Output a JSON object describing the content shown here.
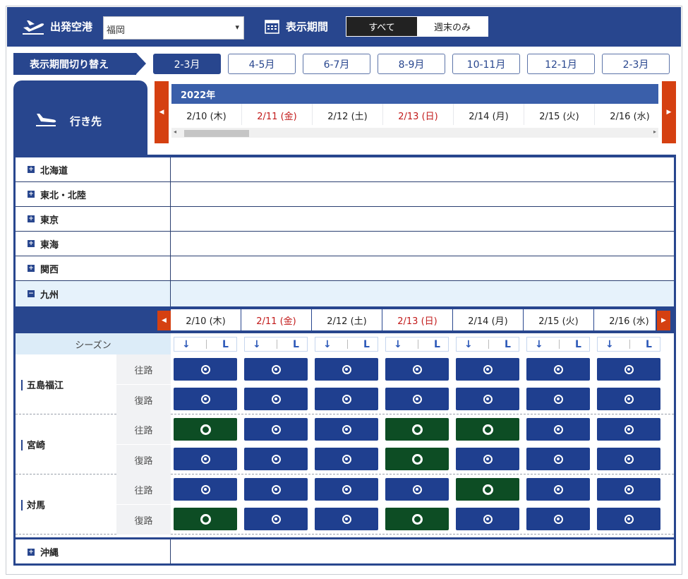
{
  "header": {
    "departure_label": "出発空港",
    "airport_value": "福岡",
    "period_label": "表示期間",
    "segment": [
      {
        "label": "すべて",
        "active": true
      },
      {
        "label": "週末のみ",
        "active": false
      }
    ]
  },
  "period_switch": {
    "label": "表示期間切り替え",
    "tabs": [
      {
        "label": "2-3月",
        "active": true
      },
      {
        "label": "4-5月"
      },
      {
        "label": "6-7月"
      },
      {
        "label": "8-9月"
      },
      {
        "label": "10-11月"
      },
      {
        "label": "12-1月"
      },
      {
        "label": "2-3月"
      }
    ]
  },
  "destination": {
    "label": "行き先"
  },
  "calendar": {
    "year": "2022年",
    "dates": [
      {
        "label": "2/10 (木)",
        "holiday": false
      },
      {
        "label": "2/11 (金)",
        "holiday": true
      },
      {
        "label": "2/12 (土)",
        "holiday": false
      },
      {
        "label": "2/13 (日)",
        "holiday": true
      },
      {
        "label": "2/14 (月)",
        "holiday": false
      },
      {
        "label": "2/15 (火)",
        "holiday": false
      },
      {
        "label": "2/16 (水)",
        "holiday": false
      }
    ],
    "prev_arrow": "◀",
    "next_arrow": "▶"
  },
  "regions": [
    {
      "name": "北海道",
      "expanded": false
    },
    {
      "name": "東北・北陸",
      "expanded": false
    },
    {
      "name": "東京",
      "expanded": false
    },
    {
      "name": "東海",
      "expanded": false
    },
    {
      "name": "関西",
      "expanded": false
    },
    {
      "name": "九州",
      "expanded": true
    },
    {
      "name": "沖縄",
      "expanded": false
    }
  ],
  "kyushu": {
    "season_label": "シーズン",
    "legend_arrow": "↓",
    "legend_letter": "L",
    "route_labels": {
      "outbound": "往路",
      "return": "復路"
    },
    "destinations": [
      {
        "name": "五島福江",
        "outbound": [
          "b",
          "b",
          "b",
          "b",
          "b",
          "b",
          "b"
        ],
        "return": [
          "b",
          "b",
          "b",
          "b",
          "b",
          "b",
          "b"
        ]
      },
      {
        "name": "宮崎",
        "outbound": [
          "g",
          "b",
          "b",
          "g",
          "g",
          "b",
          "b"
        ],
        "return": [
          "b",
          "b",
          "b",
          "g",
          "b",
          "b",
          "b"
        ]
      },
      {
        "name": "対馬",
        "outbound": [
          "b",
          "b",
          "b",
          "b",
          "g",
          "b",
          "b"
        ],
        "return": [
          "g",
          "b",
          "b",
          "g",
          "b",
          "b",
          "b"
        ]
      }
    ]
  },
  "icons": {
    "plane": "airplane-takeoff-icon",
    "calendar": "calendar-icon",
    "landing": "airplane-landing-icon"
  },
  "colors": {
    "primary": "#28468e",
    "arrow": "#d54011",
    "holiday": "#c21a1a",
    "season_blue": "#1f3f8f",
    "season_green": "#0d4d24"
  }
}
